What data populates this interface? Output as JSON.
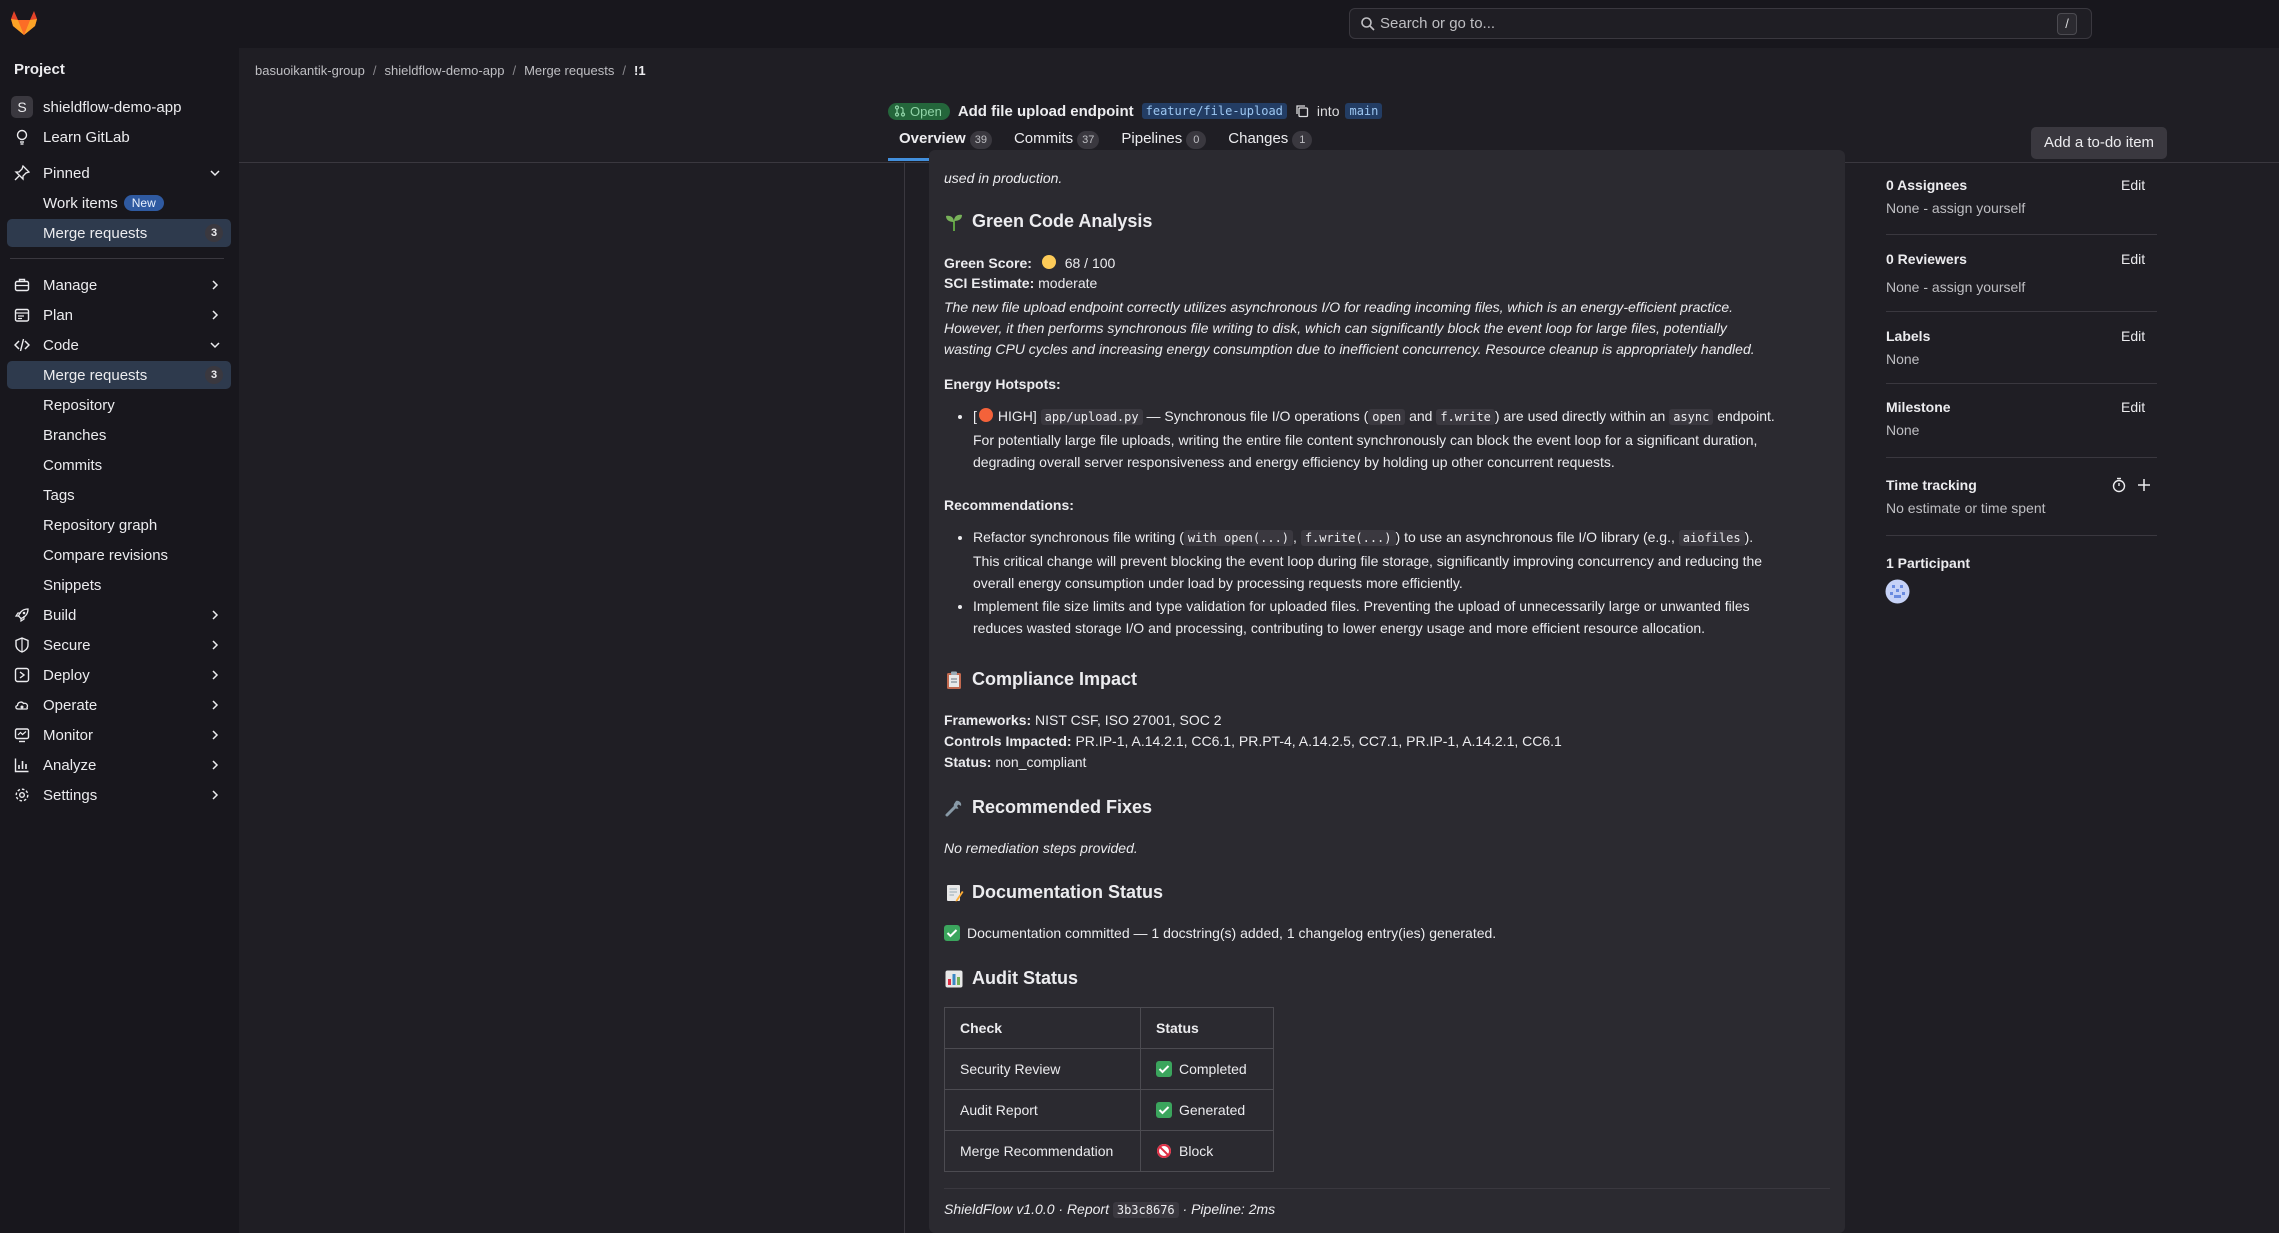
{
  "topbar": {
    "search_placeholder": "Search or go to...",
    "search_shortcut": "/"
  },
  "sidebar": {
    "heading": "Project",
    "project_name": "shieldflow-demo-app",
    "project_initial": "S",
    "learn": "Learn GitLab",
    "pinned": "Pinned",
    "pinned_items": [
      {
        "label": "Work items",
        "badge": "New"
      },
      {
        "label": "Merge requests",
        "count": "3"
      }
    ],
    "groups": [
      {
        "label": "Manage"
      },
      {
        "label": "Plan"
      },
      {
        "label": "Code"
      }
    ],
    "code_items": [
      {
        "label": "Merge requests",
        "count": "3"
      },
      {
        "label": "Repository"
      },
      {
        "label": "Branches"
      },
      {
        "label": "Commits"
      },
      {
        "label": "Tags"
      },
      {
        "label": "Repository graph"
      },
      {
        "label": "Compare revisions"
      },
      {
        "label": "Snippets"
      }
    ],
    "bottom_groups": [
      {
        "label": "Build"
      },
      {
        "label": "Secure"
      },
      {
        "label": "Deploy"
      },
      {
        "label": "Operate"
      },
      {
        "label": "Monitor"
      },
      {
        "label": "Analyze"
      },
      {
        "label": "Settings"
      }
    ]
  },
  "breadcrumb": [
    "basuoikantik-group",
    "shieldflow-demo-app",
    "Merge requests",
    "!1"
  ],
  "mr": {
    "status": "Open",
    "title": "Add file upload endpoint",
    "source_branch": "feature/file-upload",
    "into": "into",
    "target_branch": "main"
  },
  "tabs": [
    {
      "label": "Overview",
      "count": "39"
    },
    {
      "label": "Commits",
      "count": "37"
    },
    {
      "label": "Pipelines",
      "count": "0"
    },
    {
      "label": "Changes",
      "count": "1"
    }
  ],
  "todo_button": "Add a to-do item",
  "note": {
    "top_partial": "used in production.",
    "green": {
      "heading": "Green Code Analysis",
      "score_label": "Green Score:",
      "score_value": "68 / 100",
      "sci_label": "SCI Estimate:",
      "sci_value": "moderate",
      "summary": [
        "The new file upload endpoint correctly utilizes asynchronous I/O for reading incoming files, which is an energy-efficient practice.",
        "However, it then performs synchronous file writing to disk, which can significantly block the event loop for large files, potentially",
        "wasting CPU cycles and increasing energy consumption due to inefficient concurrency. Resource cleanup is appropriately handled."
      ],
      "hotspots_label": "Energy Hotspots:",
      "hotspot": {
        "pre": "[",
        "level": "HIGH]",
        "file": "app/upload.py",
        "t1": "— Synchronous file I/O operations (",
        "c1": "open",
        "t2": "and",
        "c2": "f.write",
        "t3": ") are used directly within an",
        "c3": "async",
        "t4": "endpoint.",
        "line2": "For potentially large file uploads, writing the entire file content synchronously can block the event loop for a significant duration,",
        "line3": "degrading overall server responsiveness and energy efficiency by holding up other concurrent requests."
      },
      "recommendations_label": "Recommendations:",
      "rec1": {
        "t1": "Refactor synchronous file writing (",
        "c1": "with open(...)",
        "t2": ",",
        "c2": "f.write(...)",
        "t3": ") to use an asynchronous file I/O library (e.g.,",
        "c3": "aiofiles",
        "t4": ").",
        "line2": "This critical change will prevent blocking the event loop during file storage, significantly improving concurrency and reducing the",
        "line3": "overall energy consumption under load by processing requests more efficiently."
      },
      "rec2": {
        "line1": "Implement file size limits and type validation for uploaded files. Preventing the upload of unnecessarily large or unwanted files",
        "line2": "reduces wasted storage I/O and processing, contributing to lower energy usage and more efficient resource allocation."
      }
    },
    "compliance": {
      "heading": "Compliance Impact",
      "frameworks_label": "Frameworks:",
      "frameworks": "NIST CSF, ISO 27001, SOC 2",
      "controls_label": "Controls Impacted:",
      "controls": "PR.IP-1, A.14.2.1, CC6.1, PR.PT-4, A.14.2.5, CC7.1, PR.IP-1, A.14.2.1, CC6.1",
      "status_label": "Status:",
      "status": "non_compliant"
    },
    "fixes": {
      "heading": "Recommended Fixes",
      "text": "No remediation steps provided."
    },
    "docs": {
      "heading": "Documentation Status",
      "text": "Documentation committed — 1 docstring(s) added, 1 changelog entry(ies) generated."
    },
    "audit": {
      "heading": "Audit Status",
      "columns": [
        "Check",
        "Status"
      ],
      "rows": [
        {
          "check": "Security Review",
          "status": "Completed"
        },
        {
          "check": "Audit Report",
          "status": "Generated"
        },
        {
          "check": "Merge Recommendation",
          "status": "Block"
        }
      ]
    },
    "footer": {
      "t1": "ShieldFlow v1.0.0 · Report",
      "hash": "3b3c8676",
      "t2": "· Pipeline: 2ms"
    }
  },
  "right": {
    "assignees_title": "0 Assignees",
    "assignees_value": "None - assign yourself",
    "reviewers_title": "0 Reviewers",
    "reviewers_value": "None - assign yourself",
    "labels_title": "Labels",
    "labels_value": "None",
    "milestone_title": "Milestone",
    "milestone_value": "None",
    "time_title": "Time tracking",
    "time_value": "No estimate or time spent",
    "participants_title": "1 Participant",
    "edit": "Edit"
  },
  "colors": {
    "accent": "#428fdc",
    "open_status": "#24663b",
    "background": "#1f1e24",
    "card": "#2b2a30"
  }
}
